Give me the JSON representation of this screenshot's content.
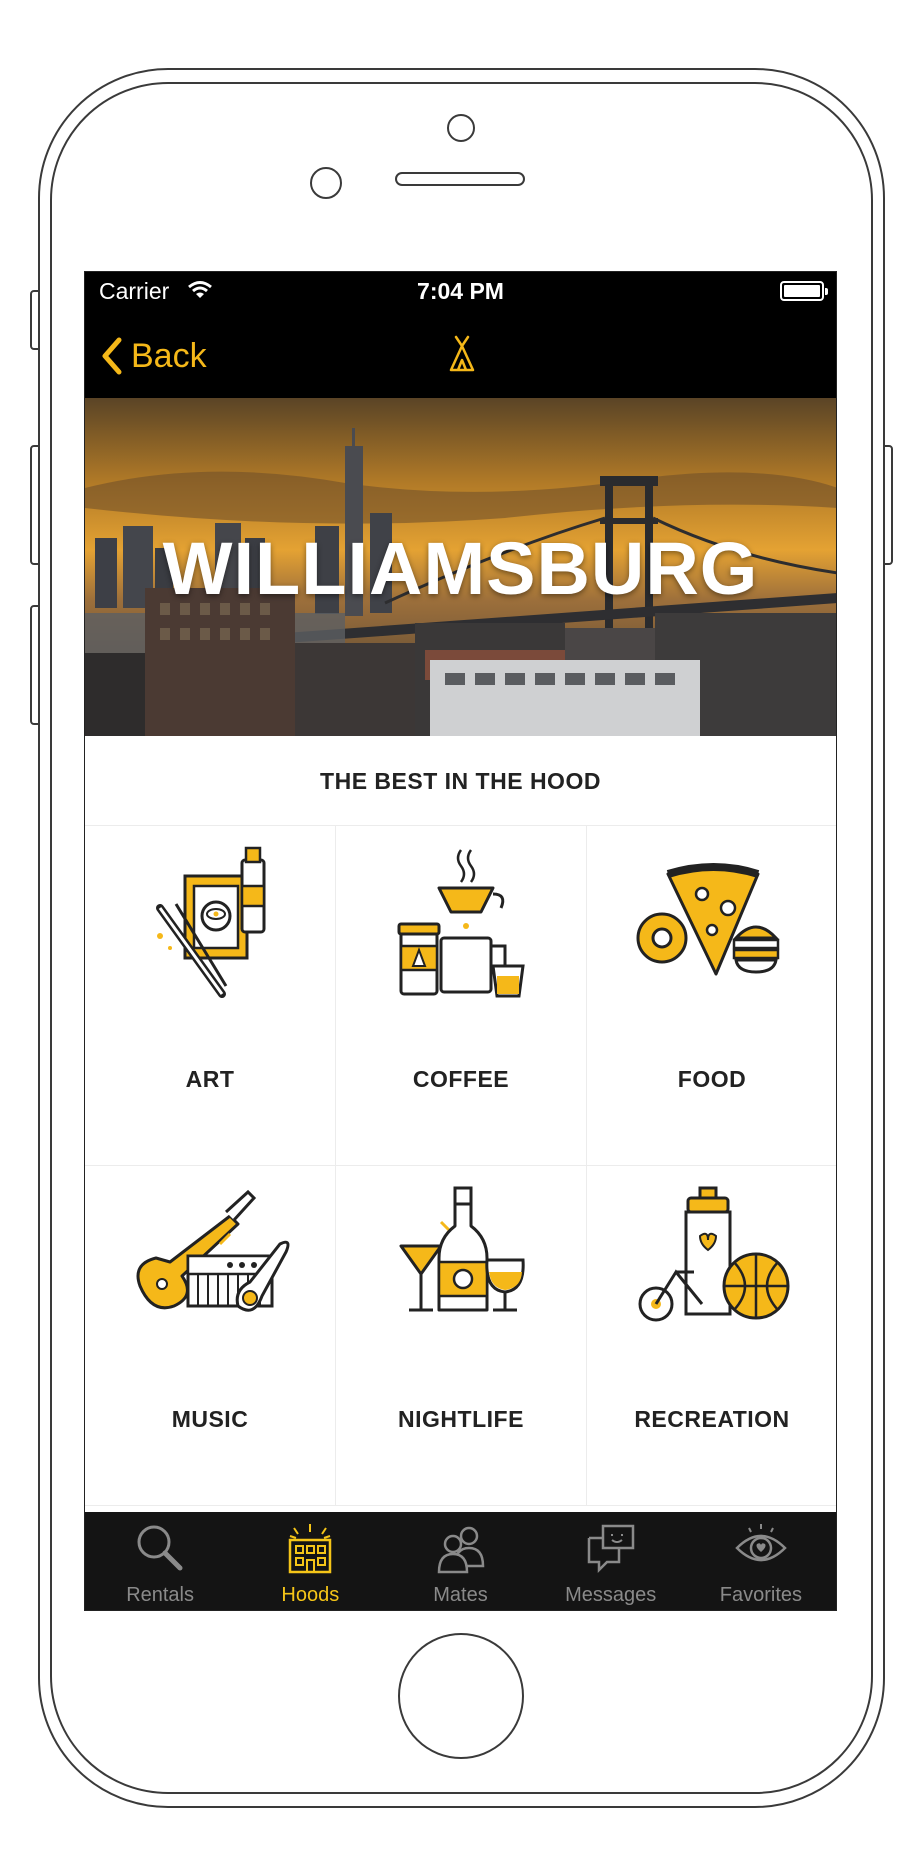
{
  "status_bar": {
    "carrier": "Carrier",
    "time": "7:04 PM"
  },
  "nav": {
    "back_label": "Back"
  },
  "hero": {
    "title": "WILLIAMSBURG"
  },
  "section": {
    "title": "THE BEST IN THE HOOD"
  },
  "categories": [
    {
      "label": "ART",
      "icon": "art-icon"
    },
    {
      "label": "COFFEE",
      "icon": "coffee-icon"
    },
    {
      "label": "FOOD",
      "icon": "food-icon"
    },
    {
      "label": "MUSIC",
      "icon": "music-icon"
    },
    {
      "label": "NIGHTLIFE",
      "icon": "nightlife-icon"
    },
    {
      "label": "RECREATION",
      "icon": "recreation-icon"
    }
  ],
  "tabs": [
    {
      "label": "Rentals",
      "icon": "search-icon"
    },
    {
      "label": "Hoods",
      "icon": "building-icon",
      "active": true
    },
    {
      "label": "Mates",
      "icon": "people-icon"
    },
    {
      "label": "Messages",
      "icon": "chat-icon"
    },
    {
      "label": "Favorites",
      "icon": "eye-heart-icon"
    }
  ],
  "colors": {
    "accent": "#f5b819",
    "active_tab": "#f5c518",
    "inactive_tab": "#8a8a8a",
    "bar_bg": "#000000"
  }
}
